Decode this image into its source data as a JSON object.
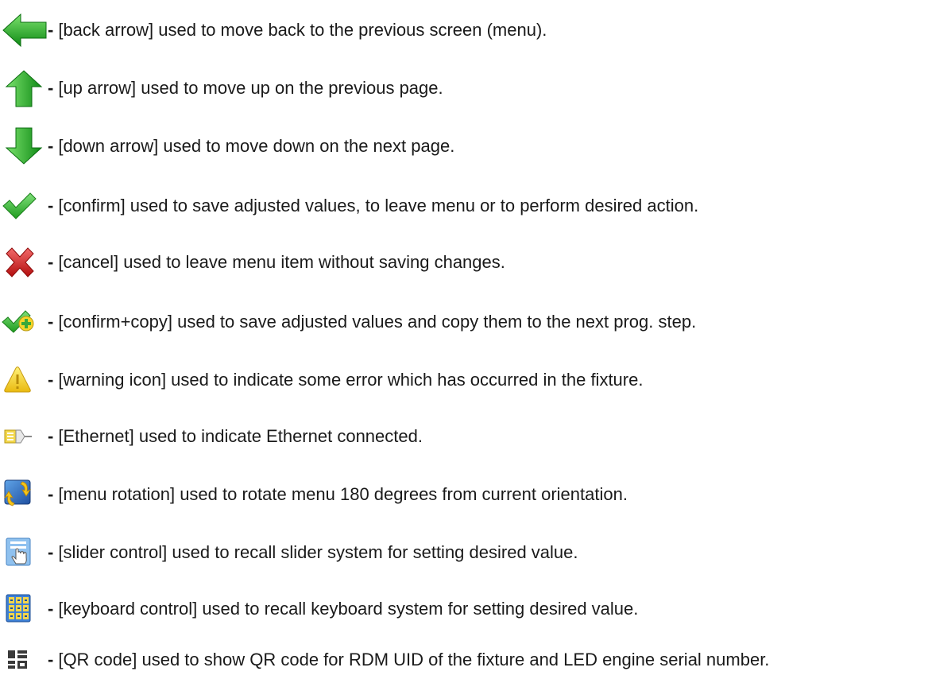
{
  "legend": {
    "items": [
      {
        "icon": "back-arrow-icon",
        "text": "[back arrow] used to move  back to the previous screen (menu)."
      },
      {
        "icon": "up-arrow-icon",
        "text": "[up arrow] used to move up on the previous page."
      },
      {
        "icon": "down-arrow-icon",
        "text": "[down arrow] used to move down on the next page."
      },
      {
        "icon": "confirm-check-icon",
        "text": "[confirm] used to save adjusted values, to leave menu or to perform desired action."
      },
      {
        "icon": "cancel-x-icon",
        "text": "[cancel] used to leave menu item without saving changes."
      },
      {
        "icon": "confirm-copy-icon",
        "text": "[confirm+copy] used to save adjusted values and copy them to the next prog. step."
      },
      {
        "icon": "warning-icon",
        "text": "[warning icon] used to indicate some error which has occurred in the fixture."
      },
      {
        "icon": "ethernet-icon",
        "text": "[Ethernet] used to indicate Ethernet connected."
      },
      {
        "icon": "menu-rotation-icon",
        "text": "[menu rotation] used to rotate menu 180 degrees from current orientation."
      },
      {
        "icon": "slider-control-icon",
        "text": "[slider control] used to recall slider system for setting desired value."
      },
      {
        "icon": "keyboard-control-icon",
        "text": "[keyboard control] used to recall keyboard system for setting desired value."
      },
      {
        "icon": "qr-code-icon",
        "text": "[QR code] used to show QR code for RDM UID of the fixture  and LED engine serial number."
      }
    ],
    "separator": "-"
  },
  "colors": {
    "arrow_green": "#1fa51f",
    "check_green": "#3cb83c",
    "cancel_red": "#d81e1e",
    "warning_yellow": "#f5d21a",
    "icon_blue": "#2f6fc4"
  }
}
